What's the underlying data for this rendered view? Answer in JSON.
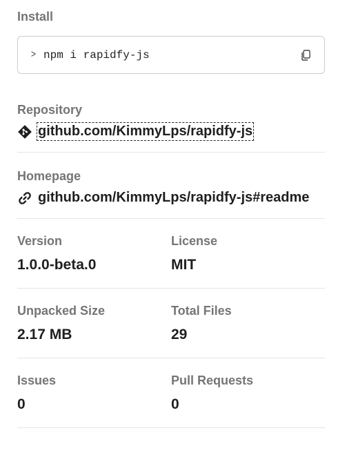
{
  "install": {
    "label": "Install",
    "prompt": ">",
    "command": "npm i rapidfy-js",
    "copy_icon": "copy-icon"
  },
  "repository": {
    "label": "Repository",
    "icon": "git-icon",
    "link": "github.com/KimmyLps/rapidfy-js"
  },
  "homepage": {
    "label": "Homepage",
    "icon": "link-icon",
    "link": "github.com/KimmyLps/rapidfy-js#readme"
  },
  "stats": {
    "version_label": "Version",
    "version_value": "1.0.0-beta.0",
    "license_label": "License",
    "license_value": "MIT",
    "unpacked_label": "Unpacked Size",
    "unpacked_value": "2.17 MB",
    "files_label": "Total Files",
    "files_value": "29",
    "issues_label": "Issues",
    "issues_value": "0",
    "pulls_label": "Pull Requests",
    "pulls_value": "0"
  },
  "colors": {
    "label": "#757575",
    "text": "#1f1f1f",
    "border": "#cccccc",
    "divider": "#e5e5e5"
  }
}
